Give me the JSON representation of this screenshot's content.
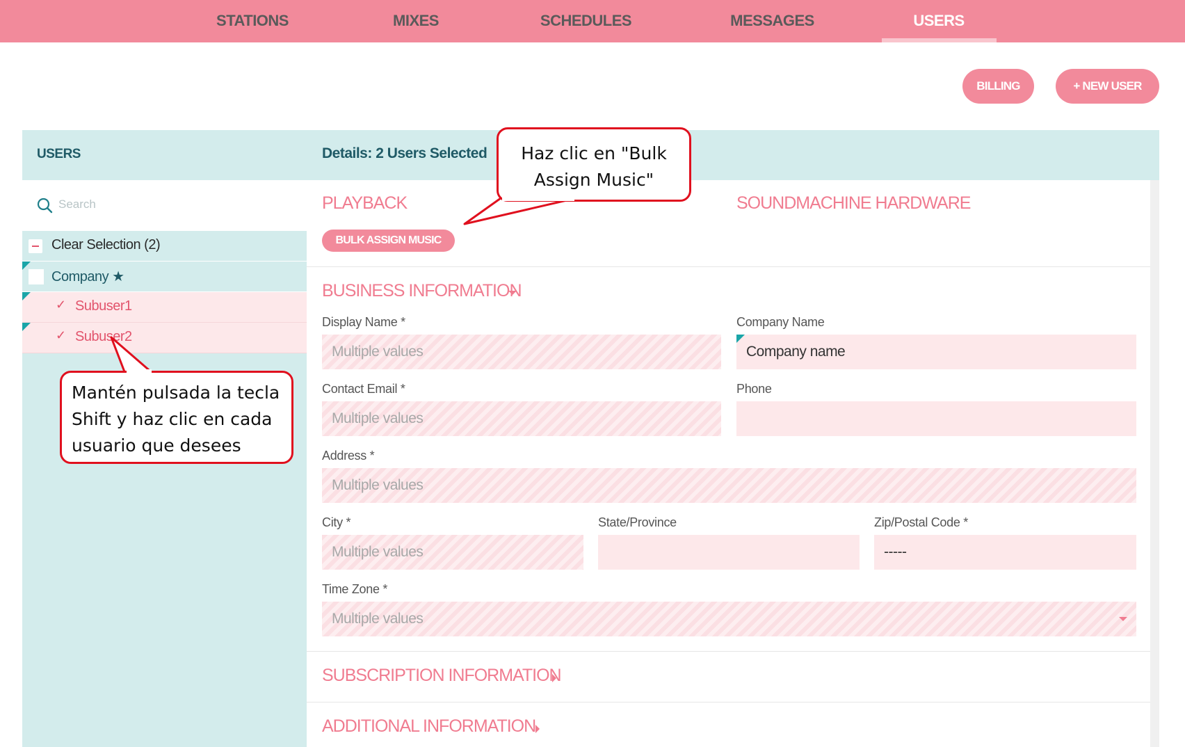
{
  "nav": {
    "items": [
      {
        "label": "STATIONS"
      },
      {
        "label": "MIXES"
      },
      {
        "label": "SCHEDULES"
      },
      {
        "label": "MESSAGES"
      },
      {
        "label": "USERS"
      }
    ],
    "active": "USERS"
  },
  "header": {
    "billing_label": "BILLING",
    "new_user_label": "+ NEW USER"
  },
  "users_panel": {
    "title": "USERS",
    "search_placeholder": "Search",
    "clear_selection": "Clear Selection (2)",
    "company": "Company ★",
    "users": [
      {
        "label": "Subuser1",
        "selected": true
      },
      {
        "label": "Subuser2",
        "selected": true
      }
    ]
  },
  "details": {
    "title": "Details: 2 Users Selected",
    "playback_title": "PLAYBACK",
    "bulk_assign_label": "BULK ASSIGN MUSIC",
    "hardware_title": "SOUNDMACHINE HARDWARE",
    "business_title": "BUSINESS INFORMATION",
    "fields": {
      "display_name": {
        "label": "Display Name *",
        "value": "Multiple values"
      },
      "company_name": {
        "label": "Company Name",
        "value": "Company name"
      },
      "contact_email": {
        "label": "Contact Email *",
        "value": "Multiple values"
      },
      "phone": {
        "label": "Phone",
        "value": ""
      },
      "address": {
        "label": "Address *",
        "value": "Multiple values"
      },
      "city": {
        "label": "City *",
        "value": "Multiple values"
      },
      "state": {
        "label": "State/Province",
        "value": ""
      },
      "zip": {
        "label": "Zip/Postal Code *",
        "value": "-----"
      },
      "timezone": {
        "label": "Time Zone *",
        "value": "Multiple values"
      }
    },
    "subscription_title": "SUBSCRIPTION INFORMATION",
    "additional_title": "ADDITIONAL INFORMATION"
  },
  "callouts": {
    "bulk": "Haz clic en \"Bulk Assign Music\"",
    "shift": "Mantén pulsada la tecla Shift y haz clic en cada usuario que desees"
  },
  "colors": {
    "nav_bg": "#f28a9b",
    "accent": "#f07c90",
    "panel_teal": "#d3ecec",
    "field_pink": "#fde8ea",
    "callout_red": "#e0101e"
  }
}
